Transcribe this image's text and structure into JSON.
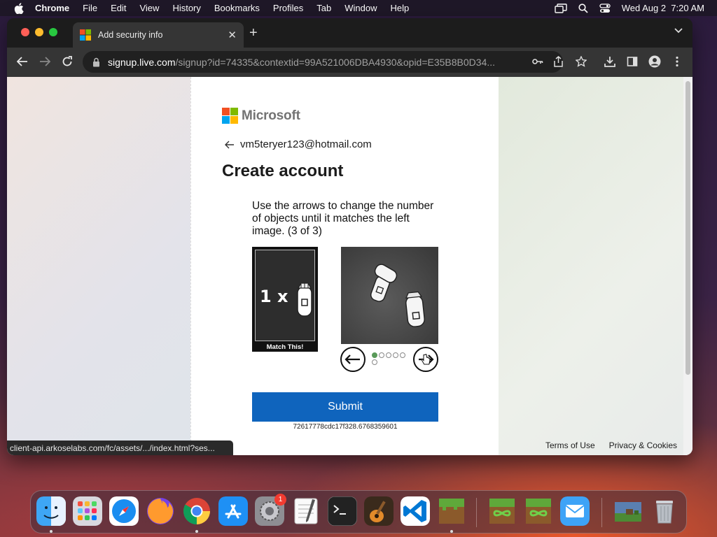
{
  "menubar": {
    "app": "Chrome",
    "items": [
      "File",
      "Edit",
      "View",
      "History",
      "Bookmarks",
      "Profiles",
      "Tab",
      "Window",
      "Help"
    ],
    "clock": "Wed Aug 2  7:20 AM"
  },
  "browser": {
    "tab_title": "Add security info",
    "url_host": "signup.live.com",
    "url_path": "/signup?id=74335&contextid=99A521006DBA4930&opid=E35B8B0D34...",
    "status_url": "client-api.arkoselabs.com/fc/assets/.../index.html?ses..."
  },
  "page": {
    "brand": "Microsoft",
    "email": "vm5teryer123@hotmail.com",
    "title": "Create account",
    "instruction": "Use the arrows to change the number of objects until it matches the left image. (3 of 3)",
    "match_label": "Match This!",
    "match_prefix": "1 x",
    "submit_label": "Submit",
    "session_code": "72617778cdc17f328.6768359601",
    "footer": {
      "terms": "Terms of Use",
      "privacy": "Privacy & Cookies"
    }
  },
  "carousel": {
    "total": 6,
    "active": 0
  },
  "dock": {
    "settings_badge": "1",
    "apps": [
      "finder-icon",
      "launchpad-icon",
      "safari-icon",
      "firefox-icon",
      "chrome-icon",
      "app-store-icon",
      "system-settings-icon",
      "textedit-icon",
      "terminal-icon",
      "garageband-icon",
      "vscode-icon",
      "minecraft-icon",
      "minecraft-launcher-icon",
      "minecraft-launcher-2-icon",
      "mail-icon",
      "minecraft-world-icon",
      "trash-icon"
    ]
  },
  "colors": {
    "submit": "#0f64bd",
    "ms_red": "#f25022",
    "ms_green": "#7fba00",
    "ms_blue": "#00a4ef",
    "ms_yellow": "#ffb900"
  }
}
